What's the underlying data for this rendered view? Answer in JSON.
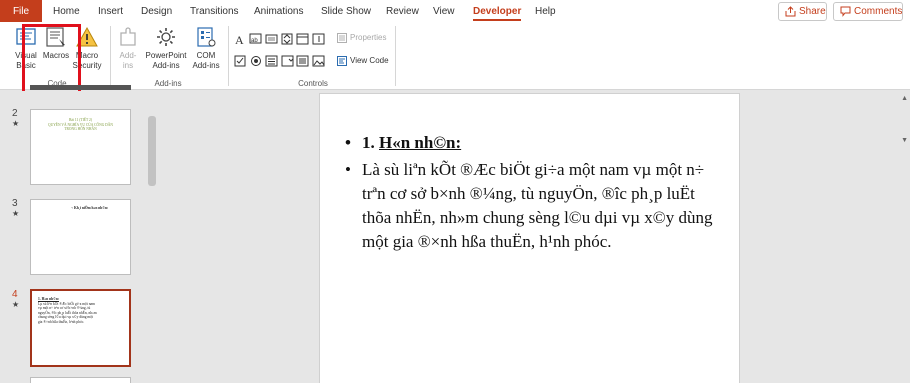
{
  "tabs": {
    "file": "File",
    "home": "Home",
    "insert": "Insert",
    "design": "Design",
    "transitions": "Transitions",
    "animations": "Animations",
    "slide_show": "Slide Show",
    "review": "Review",
    "view": "View",
    "developer": "Developer",
    "help": "Help"
  },
  "top_buttons": {
    "share": "Share",
    "comments": "Comments"
  },
  "ribbon": {
    "code": {
      "visual_basic_1": "Visual",
      "visual_basic_2": "Basic",
      "macros": "Macros",
      "macro_security_1": "Macro",
      "macro_security_2": "Security",
      "group_label": "Code"
    },
    "addins": {
      "addins_1": "Add-",
      "addins_2": "ins",
      "powerpoint_addins_1": "PowerPoint",
      "powerpoint_addins_2": "Add-ins",
      "com_addins_1": "COM",
      "com_addins_2": "Add-ins",
      "group_label": "Add-ins"
    },
    "controls": {
      "properties": "Properties",
      "view_code": "View Code",
      "group_label": "Controls"
    }
  },
  "colors": {
    "accent": "#c43e1c",
    "highlight_box": "#e0101c"
  },
  "thumbnails": [
    {
      "number": "2",
      "star": "★",
      "lines": [
        "Bài 11 (TIẾT 2)",
        "QUYỀN VÀ NGHĨA VỤ CỦA CÔNG DÂN",
        "TRONG HÔN NHÂN"
      ]
    },
    {
      "number": "3",
      "star": "★",
      "lines": [
        "¬ Kh¸i niÖm h«n nh©n:"
      ]
    },
    {
      "number": "4",
      "star": "★",
      "lines": [
        "1. H«n nh©n:",
        "Lµ sù liªn kÕt ®Æc biÖt gi÷a một nam vµ một n÷ trªn cơ sở b×nh ®¼ng, tù nguyÖn, ®­îc ph¸p luËt thõa nhËn, nh»m chung sèng l©u dµi vµ x©y dùng một gia ®×nh hßa thuËn, h¹nh phóc."
      ]
    }
  ],
  "slide": {
    "bullet1_num": "1.",
    "bullet1_text": "H«n nh©n:",
    "bullet2_text": "Là sù liªn kÕt ®Æc biÖt gi÷a một nam vµ một n÷ trªn cơ sở b×nh ®¼ng, tù nguyÖn, ®­îc ph¸p luËt thõa nhËn, nh»m chung sèng l©u dµi vµ x©y dùng một gia ®×nh hßa thuËn, h¹nh phóc."
  }
}
